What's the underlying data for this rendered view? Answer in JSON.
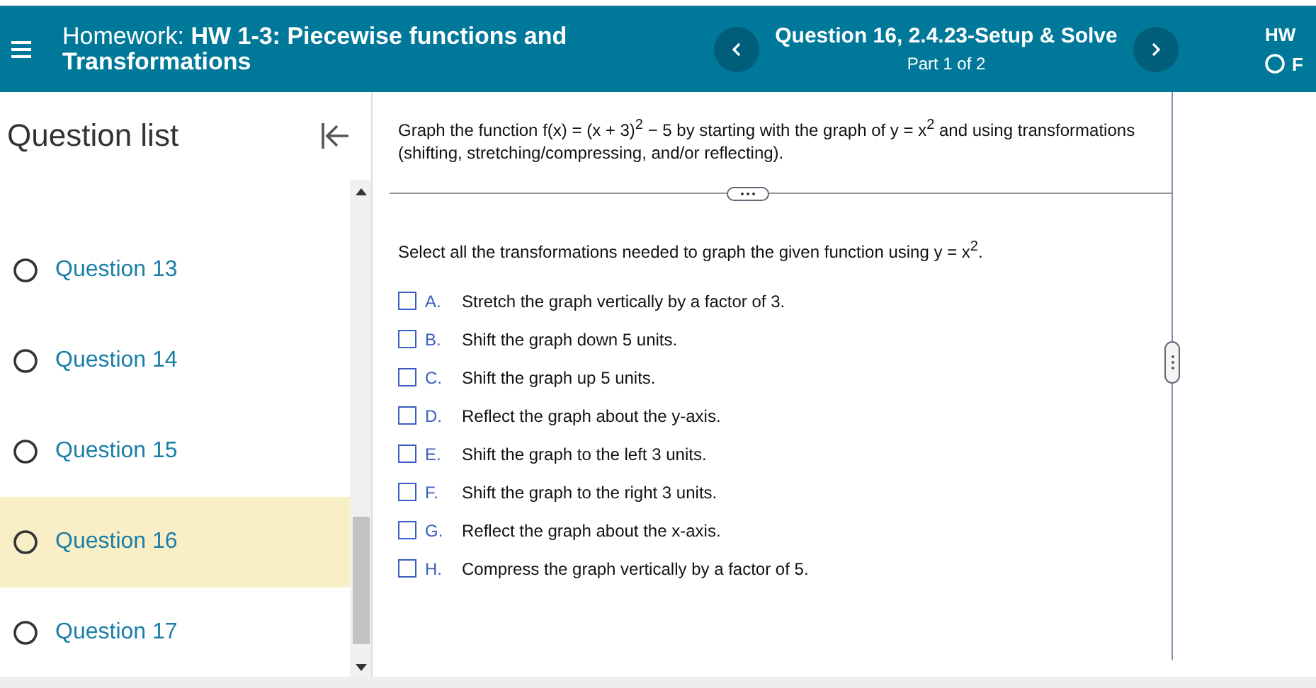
{
  "header": {
    "title": "Homework:  **HW 1-3: Piecewise functions and Transformations**",
    "question_title": "Question 16, 2.4.23-Setup & Solve",
    "part": "Part 1 of 2",
    "right_title": "HW",
    "right_status": "F"
  },
  "sidebar": {
    "title": "Question list",
    "items": [
      {
        "label": "Question 13",
        "selected": false
      },
      {
        "label": "Question 14",
        "selected": false
      },
      {
        "label": "Question 15",
        "selected": false
      },
      {
        "label": "Question 16",
        "selected": true
      },
      {
        "label": "Question 17",
        "selected": false
      }
    ]
  },
  "question": {
    "prompt": "Graph the function f(x) = (x + 3)$^{2}$ − 5 by starting with the graph of y = x$^{2}$ and using transformations (shifting, stretching/compressing, and/or reflecting).",
    "instruction": "Select all the transformations needed to graph the given function using y = x$^{2}$.",
    "options": [
      {
        "letter": "A.",
        "text": "Stretch the graph vertically by a factor of 3.",
        "checked": false
      },
      {
        "letter": "B.",
        "text": "Shift the graph down 5 units.",
        "checked": false
      },
      {
        "letter": "C.",
        "text": "Shift the graph up 5 units.",
        "checked": false
      },
      {
        "letter": "D.",
        "text": "Reflect the graph about the y-axis.",
        "checked": false
      },
      {
        "letter": "E.",
        "text": "Shift the graph to the left 3 units.",
        "checked": false
      },
      {
        "letter": "F.",
        "text": "Shift the graph to the right 3 units.",
        "checked": false
      },
      {
        "letter": "G.",
        "text": "Reflect the graph about the x-axis.",
        "checked": false
      },
      {
        "letter": "H.",
        "text": "Compress the graph vertically by a factor of 5.",
        "checked": false
      }
    ]
  }
}
